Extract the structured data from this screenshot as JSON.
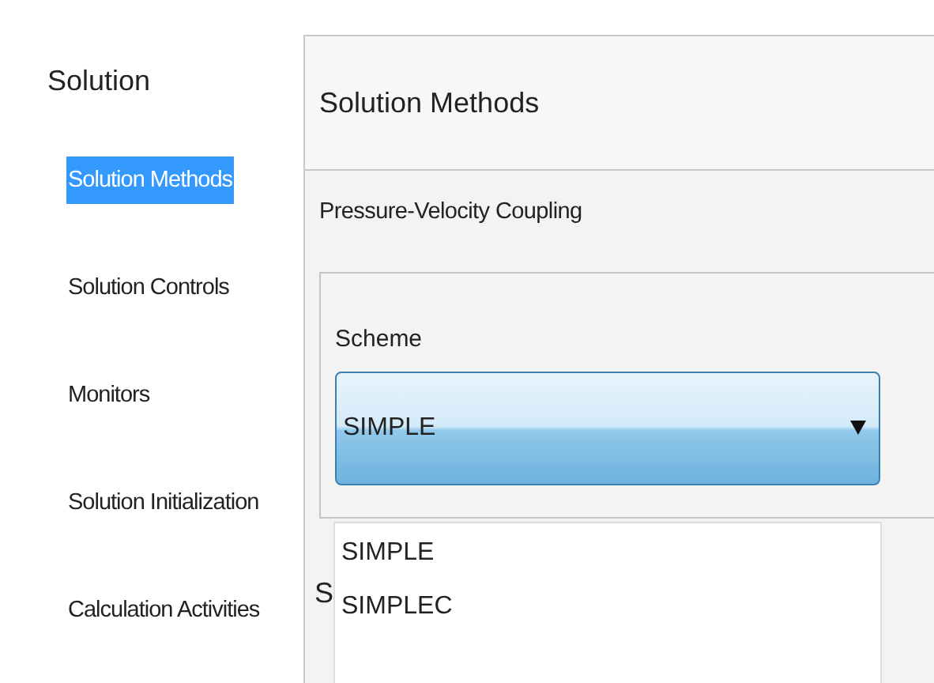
{
  "tree": {
    "title": "Solution",
    "items": [
      {
        "label": "Solution Methods",
        "selected": true
      },
      {
        "label": "Solution Controls",
        "selected": false
      },
      {
        "label": "Monitors",
        "selected": false
      },
      {
        "label": "Solution Initialization",
        "selected": false
      },
      {
        "label": "Calculation Activities",
        "selected": false
      }
    ]
  },
  "panel": {
    "title": "Solution Methods",
    "section_label": "Pressure-Velocity Coupling",
    "scheme": {
      "label": "Scheme",
      "value": "SIMPLE",
      "expanded": true,
      "options": [
        {
          "label": "SIMPLE"
        },
        {
          "label": "SIMPLEC"
        }
      ]
    },
    "hidden_label": "S"
  }
}
